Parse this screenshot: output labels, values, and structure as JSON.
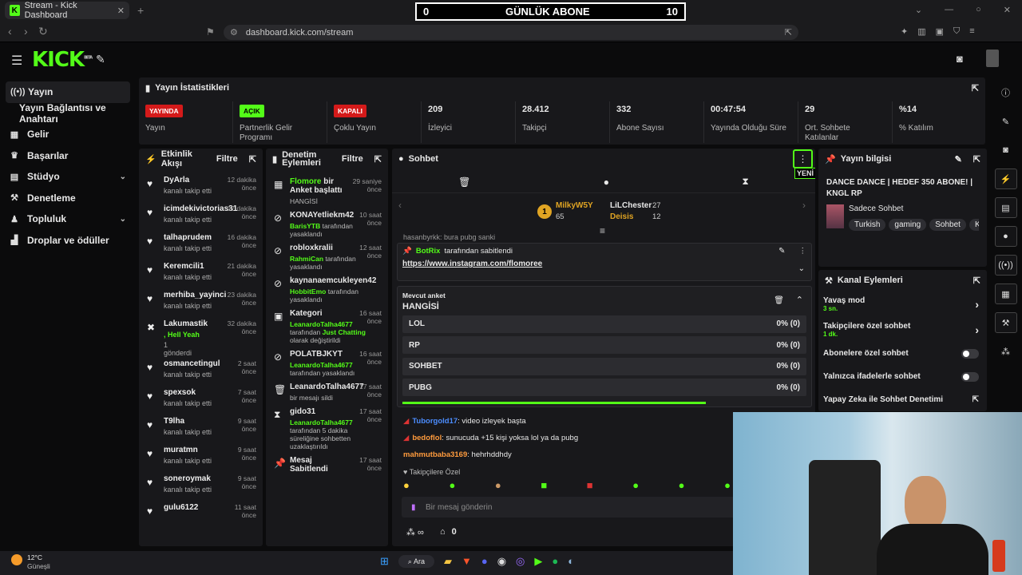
{
  "browser": {
    "tab_title": "Stream - Kick Dashboard",
    "url": "dashboard.kick.com/stream"
  },
  "overlay": {
    "left": "0",
    "label": "GÜNLÜK ABONE",
    "right": "10"
  },
  "brand": {
    "logo": "KICK",
    "beta": "BETA"
  },
  "sidebar": {
    "items": [
      {
        "label": "Yayın",
        "icon": "broadcast-icon"
      },
      {
        "label": "Yayın Bağlantısı ve Anahtarı"
      },
      {
        "label": "Gelir",
        "icon": "revenue-icon"
      },
      {
        "label": "Başarılar",
        "icon": "trophy-icon"
      },
      {
        "label": "Stüdyo",
        "icon": "studio-icon"
      },
      {
        "label": "Denetleme",
        "icon": "wrench-icon"
      },
      {
        "label": "Topluluk",
        "icon": "community-icon"
      },
      {
        "label": "Droplar ve ödüller",
        "icon": "drops-icon"
      }
    ]
  },
  "stats": {
    "title": "Yayın İstatistikleri",
    "cells": [
      {
        "badge": "YAYINDA",
        "label": "Yayın"
      },
      {
        "badge": "AÇIK",
        "label": "Partnerlik Gelir Programı"
      },
      {
        "badge": "KAPALI",
        "label": "Çoklu Yayın"
      },
      {
        "value": "209",
        "label": "İzleyici"
      },
      {
        "value": "28.412",
        "label": "Takipçi"
      },
      {
        "value": "332",
        "label": "Abone Sayısı"
      },
      {
        "value": "00:47:54",
        "label": "Yayında Olduğu Süre"
      },
      {
        "value": "29",
        "label": "Ort. Sohbete Katılanlar"
      },
      {
        "value": "%14",
        "label": "% Katılım"
      }
    ]
  },
  "activity": {
    "title": "Etkinlik Akışı",
    "filter": "Filtre",
    "items": [
      {
        "name": "DyArla",
        "time": "12 dakika önce",
        "sub": "kanalı takip etti"
      },
      {
        "name": "icimdekivictorias31",
        "time": "17 dakika önce",
        "sub": "kanalı takip etti"
      },
      {
        "name": "talhaprudem",
        "time": "16 dakika önce",
        "sub": "kanalı takip etti"
      },
      {
        "name": "Keremcili1",
        "time": "21 dakika önce",
        "sub": "kanalı takip etti"
      },
      {
        "name": "merhiba_yayinci",
        "time": "23 dakika önce",
        "sub": "kanalı takip etti"
      },
      {
        "name": "Lakumastik",
        "time": "32 dakika önce",
        "sub": ", Hell Yeah",
        "sub2": "1",
        "sub3": "gönderdi"
      },
      {
        "name": "osmancetingul",
        "time": "2 saat önce",
        "sub": "kanalı takip etti"
      },
      {
        "name": "spexsok",
        "time": "7 saat önce",
        "sub": "kanalı takip etti"
      },
      {
        "name": "T9lha",
        "time": "9 saat önce",
        "sub": "kanalı takip etti"
      },
      {
        "name": "muratmn",
        "time": "9 saat önce",
        "sub": "kanalı takip etti"
      },
      {
        "name": "soneroymak",
        "time": "9 saat önce",
        "sub": "kanalı takip etti"
      },
      {
        "name": "gulu6122",
        "time": "11 saat önce",
        "sub": ""
      }
    ]
  },
  "moderation": {
    "title": "Denetim Eylemleri",
    "filter": "Filtre",
    "items": [
      {
        "head": "Flomore",
        "head2": " bir Anket başlattı",
        "sub": "HANGİSİ",
        "time": "29 saniye önce"
      },
      {
        "head": "KONAYetliekm42",
        "sub": "BarisYTB",
        "sub2": " tarafından yasaklandı",
        "time": "10 saat önce"
      },
      {
        "head": "robloxkralii",
        "sub": "RahmiCan",
        "sub2": " tarafından yasaklandı",
        "time": "12 saat önce"
      },
      {
        "head": "kaynanaemcukleyen42",
        "sub": "HobbitEmo",
        "sub2": " tarafından yasaklandı",
        "time": ""
      },
      {
        "head": "Kategori",
        "sub": "LeanardoTalha4677",
        "sub2": " tarafından ",
        "sub3": "Just Chatting",
        "sub4": " olarak değiştirildi",
        "time": "16 saat önce"
      },
      {
        "head": "POLATBJKYT",
        "sub": "LeanardoTalha4677",
        "sub2": " tarafından yasaklandı",
        "time": "16 saat önce"
      },
      {
        "head": "LeanardoTalha4677",
        "sub": "bir mesajı sildi",
        "time": "17 saat önce"
      },
      {
        "head": "gido31",
        "sub": "LeanardoTalha4677",
        "sub2": " tarafından 5 dakika süreliğine sohbetten uzaklaştırıldı",
        "time": "17 saat önce"
      },
      {
        "head": "Mesaj Sabitlendi",
        "time": "17 saat önce"
      }
    ]
  },
  "chat": {
    "title": "Sohbet",
    "new_badge": "YENİ",
    "leaders": [
      {
        "rank": "1",
        "name": "MilkyW5Y",
        "count": "65"
      },
      {
        "name": "LiLChester",
        "count": "27"
      },
      {
        "name": "Deisis",
        "count": "12"
      }
    ],
    "pinned": {
      "by": "BotRix",
      "by_suffix": " tarafından sabitlendi",
      "link": "https://www.instagram.com/flomoree",
      "behind": "hasanbyrkk: bura pubg sanki"
    },
    "poll": {
      "label": "Mevcut anket",
      "question": "HANGİSİ",
      "options": [
        {
          "name": "LOL",
          "result": "0% (0)"
        },
        {
          "name": "RP",
          "result": "0% (0)"
        },
        {
          "name": "SOHBET",
          "result": "0% (0)"
        },
        {
          "name": "PUBG",
          "result": "0% (0)"
        }
      ]
    },
    "messages": [
      {
        "user": "Tuborgold17",
        "text": ": video izleyek başta"
      },
      {
        "user": "bedoflol",
        "text": ": sunucuda +15 kişi yoksa lol ya da pubg"
      },
      {
        "user": "mahmutbaba3169",
        "text": ": hehrhddhdy"
      }
    ],
    "followers_only": "Takipçilere Özel",
    "input_placeholder": "Bir mesaj gönderin",
    "points": "0"
  },
  "stream_info": {
    "title": "Yayın bilgisi",
    "stream_title": "DANCE DANCE | HEDEF 350 ABONE! | KNGL RP",
    "category": "Sadece Sohbet",
    "tags": [
      "Turkish",
      "gaming",
      "Sohbet",
      "KN"
    ]
  },
  "channel_actions": {
    "title": "Kanal Eylemleri",
    "rows": [
      {
        "label": "Yavaş mod",
        "sub": "3 sn."
      },
      {
        "label": "Takipçilere özel sohbet",
        "sub": "1 dk."
      },
      {
        "label": "Abonelere özel sohbet"
      },
      {
        "label": "Yalnızca ifadelerle sohbet"
      },
      {
        "label": "Yapay Zeka ile Sohbet Denetimi"
      }
    ]
  },
  "taskbar": {
    "temp": "12°C",
    "weather": "Güneşli",
    "search": "Ara"
  }
}
